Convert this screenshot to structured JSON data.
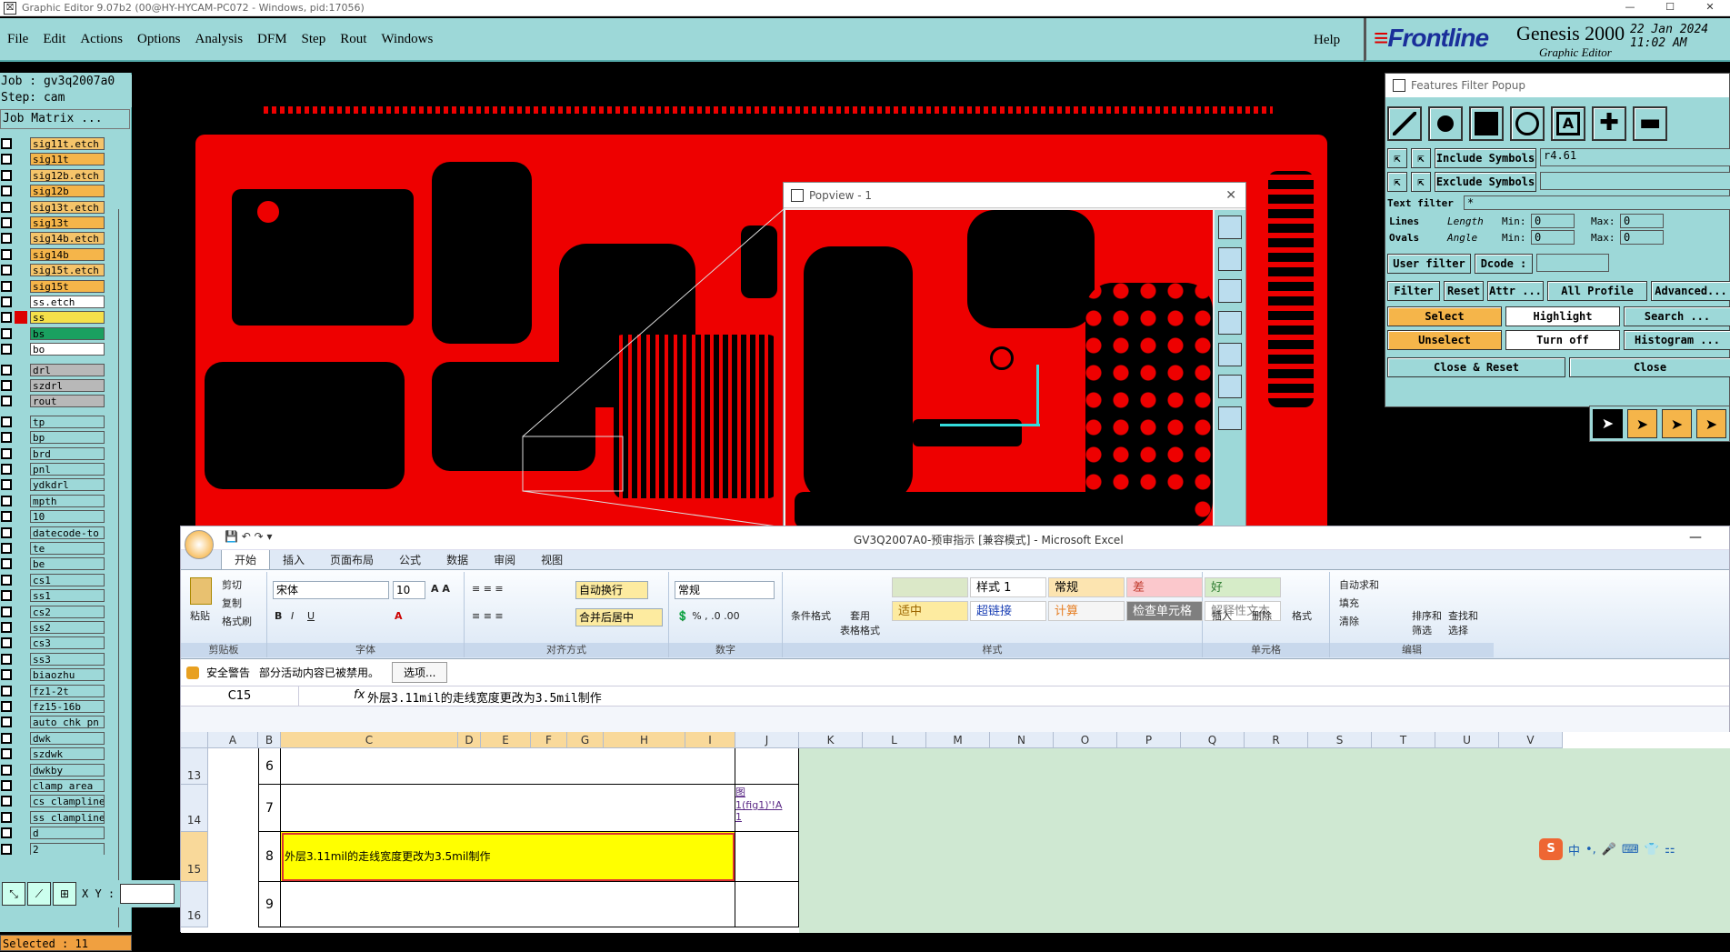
{
  "window": {
    "title": "Graphic Editor 9.07b2 (00@HY-HYCAM-PC072 - Windows, pid:17056)",
    "min": "—",
    "max": "☐",
    "close": "✕"
  },
  "menu": {
    "items": [
      "File",
      "Edit",
      "Actions",
      "Options",
      "Analysis",
      "DFM",
      "Step",
      "Rout",
      "Windows"
    ],
    "help": "Help"
  },
  "brand": {
    "logo": "Frontline",
    "product": "Genesis 2000",
    "subtitle": "Graphic Editor",
    "date": "22 Jan 2024",
    "time": "11:02 AM"
  },
  "leftpanel": {
    "job": "Job  : gv3q2007a0",
    "step": "Step: cam",
    "job_matrix": "Job Matrix ...",
    "layers": [
      {
        "name": "sig11t.etch",
        "color": "#f5c46a"
      },
      {
        "name": "sig11t",
        "color": "#f5b54a"
      },
      {
        "name": "sig12b.etch",
        "color": "#f5c46a"
      },
      {
        "name": "sig12b",
        "color": "#f5b54a"
      },
      {
        "name": "sig13t.etch",
        "color": "#f5c46a"
      },
      {
        "name": "sig13t",
        "color": "#f5b54a"
      },
      {
        "name": "sig14b.etch",
        "color": "#f5c46a"
      },
      {
        "name": "sig14b",
        "color": "#f5b54a"
      },
      {
        "name": "sig15t.etch",
        "color": "#f5c46a"
      },
      {
        "name": "sig15t",
        "color": "#f5b54a"
      },
      {
        "name": "ss.etch",
        "color": "#ffffff"
      },
      {
        "name": "ss",
        "color": "#f5e04a"
      },
      {
        "name": "bs",
        "color": "#1aa060"
      },
      {
        "name": "bo",
        "color": "#ffffff"
      },
      {
        "name": "drl",
        "color": "#b8b8b8"
      },
      {
        "name": "szdrl",
        "color": "#b8b8b8"
      },
      {
        "name": "rout",
        "color": "#b8b8b8"
      },
      {
        "name": "tp",
        "color": "#9dd8d8"
      },
      {
        "name": "bp",
        "color": "#9dd8d8"
      },
      {
        "name": "brd",
        "color": "#9dd8d8"
      },
      {
        "name": "pnl",
        "color": "#9dd8d8"
      },
      {
        "name": "ydkdrl",
        "color": "#9dd8d8"
      },
      {
        "name": "mpth",
        "color": "#9dd8d8"
      },
      {
        "name": "10",
        "color": "#9dd8d8"
      },
      {
        "name": "datecode-to",
        "color": "#9dd8d8"
      },
      {
        "name": "te",
        "color": "#9dd8d8"
      },
      {
        "name": "be",
        "color": "#9dd8d8"
      },
      {
        "name": "cs1",
        "color": "#9dd8d8"
      },
      {
        "name": "ss1",
        "color": "#9dd8d8"
      },
      {
        "name": "cs2",
        "color": "#9dd8d8"
      },
      {
        "name": "ss2",
        "color": "#9dd8d8"
      },
      {
        "name": "cs3",
        "color": "#9dd8d8"
      },
      {
        "name": "ss3",
        "color": "#9dd8d8"
      },
      {
        "name": "biaozhu",
        "color": "#9dd8d8"
      },
      {
        "name": "fz1-2t",
        "color": "#9dd8d8"
      },
      {
        "name": "fz15-16b",
        "color": "#9dd8d8"
      },
      {
        "name": "auto_chk_pn",
        "color": "#9dd8d8"
      },
      {
        "name": "dwk",
        "color": "#9dd8d8"
      },
      {
        "name": "szdwk",
        "color": "#9dd8d8"
      },
      {
        "name": "dwkby",
        "color": "#9dd8d8"
      },
      {
        "name": "clamp_area",
        "color": "#9dd8d8"
      },
      {
        "name": "cs_clampline",
        "color": "#9dd8d8"
      },
      {
        "name": "ss_clampline",
        "color": "#9dd8d8"
      },
      {
        "name": "d",
        "color": "#9dd8d8"
      },
      {
        "name": "2",
        "color": "#9dd8d8"
      }
    ],
    "selected": "Selected : 11",
    "xy_label": "X Y :"
  },
  "popview": {
    "title": "Popview - 1"
  },
  "features": {
    "title": "Features Filter Popup",
    "include_label": "Include Symbols :",
    "include_value": "r4.61",
    "exclude_label": "Exclude Symbols :",
    "text_filter": "Text filter",
    "text_filter_value": "*",
    "lines": "Lines",
    "ovals": "Ovals",
    "length": "Length",
    "angle": "Angle",
    "min": "Min:",
    "max": "Max:",
    "zero": "0",
    "user_filter": "User filter ...",
    "dcode": "Dcode :",
    "filter": "Filter",
    "reset": "Reset",
    "attr": "Attr ...",
    "all_profile": "All Profile",
    "advanced": "Advanced...",
    "select": "Select",
    "highlight": "Highlight",
    "search": "Search ...",
    "unselect": "Unselect",
    "turn_off": "Turn off",
    "histogram": "Histogram ...",
    "close_reset": "Close & Reset",
    "close": "Close"
  },
  "excel": {
    "title": "GV3Q2007A0-预审指示 [兼容模式] - Microsoft Excel",
    "tabs": [
      "开始",
      "插入",
      "页面布局",
      "公式",
      "数据",
      "审阅",
      "视图"
    ],
    "clipboard": {
      "paste": "粘贴",
      "cut": "剪切",
      "copy": "复制",
      "format_painter": "格式刷",
      "label": "剪贴板"
    },
    "font": {
      "name": "宋体",
      "size": "10",
      "label": "字体"
    },
    "align": {
      "wrap": "自动换行",
      "merge": "合并后居中",
      "label": "对齐方式"
    },
    "number": {
      "format": "常规",
      "label": "数字"
    },
    "styles": {
      "cond": "条件格式",
      "table": "套用\n表格格式",
      "label": "样式",
      "cells": [
        {
          "t": "",
          "bg": "#dbe8c8",
          "c": "#333"
        },
        {
          "t": "样式 1",
          "bg": "#fff",
          "c": "#000"
        },
        {
          "t": "常规",
          "bg": "#fce4b0",
          "c": "#000"
        },
        {
          "t": "差",
          "bg": "#fbc8cc",
          "c": "#c0392b"
        },
        {
          "t": "好",
          "bg": "#d6ecc8",
          "c": "#2e7d32"
        },
        {
          "t": "适中",
          "bg": "#fdeba0",
          "c": "#9c6500"
        },
        {
          "t": "超链接",
          "bg": "#fff",
          "c": "#1a3fb4"
        },
        {
          "t": "计算",
          "bg": "#f5f5f5",
          "c": "#e67e22"
        },
        {
          "t": "检查单元格",
          "bg": "#7f7f7f",
          "c": "#fff"
        },
        {
          "t": "解释性文本",
          "bg": "#fff",
          "c": "#888"
        }
      ]
    },
    "cells_group": {
      "insert": "插入",
      "delete": "删除",
      "format": "格式",
      "label": "单元格"
    },
    "edit": {
      "autosum": "自动求和",
      "fill": "填充",
      "clear": "清除",
      "sort": "排序和\n筛选",
      "find": "查找和\n选择",
      "label": "编辑"
    },
    "security": {
      "title": "安全警告",
      "msg": "部分活动内容已被禁用。",
      "options": "选项..."
    },
    "namebox": "C15",
    "formula": "外层3.11mil的走线宽度更改为3.5mil制作",
    "columns": [
      "A",
      "B",
      "C",
      "D",
      "E",
      "F",
      "G",
      "H",
      "I",
      "J",
      "K",
      "L",
      "M",
      "N",
      "O",
      "P",
      "Q",
      "R",
      "S",
      "T",
      "U",
      "V"
    ],
    "rows": [
      {
        "num": "13",
        "b": "6",
        "j": ""
      },
      {
        "num": "14",
        "b": "7",
        "j": "图\n1(fig1)'!A\n1"
      },
      {
        "num": "15",
        "b": "8",
        "c": "外层3.11mil的走线宽度更改为3.5mil制作",
        "j": ""
      },
      {
        "num": "16",
        "b": "9",
        "j": ""
      }
    ]
  },
  "ime": {
    "logo": "S",
    "lang": "中"
  }
}
